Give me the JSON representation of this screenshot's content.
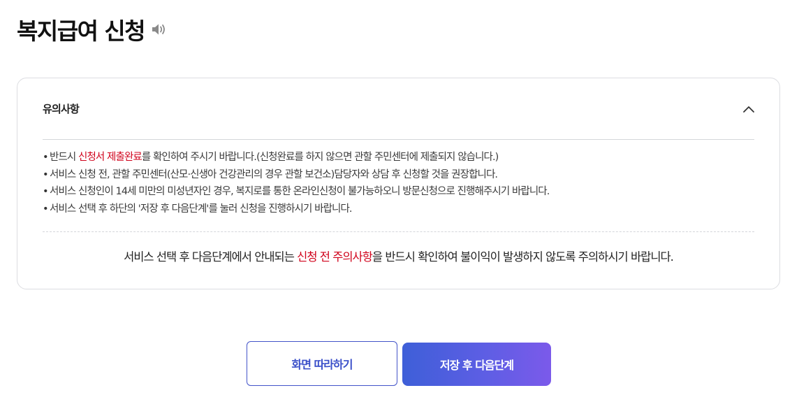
{
  "page": {
    "title": "복지급여 신청",
    "speaker_icon": "speaker-icon"
  },
  "notice": {
    "title": "유의사항",
    "toggle_icon": "chevron-up-icon",
    "items": [
      {
        "bullet": "•",
        "before": "반드시 ",
        "highlight": "신청서 제출완료",
        "after": "를 확인하여 주시기 바랍니다.(신청완료를 하지 않으면 관할 주민센터에 제출되지 않습니다.)"
      },
      {
        "bullet": "•",
        "text": "서비스 신청 전, 관할 주민센터(산모·신생아 건강관리의 경우 관할 보건소)담당자와 상담 후 신청할 것을 권장합니다."
      },
      {
        "bullet": "•",
        "text": "서비스 신청인이 14세 미만의 미성년자인 경우, 복지로를 통한 온라인신청이 불가능하오니 방문신청으로 진행해주시기 바랍니다."
      },
      {
        "bullet": "•",
        "text": "서비스 선택 후 하단의 '저장 후 다음단계'를 눌러 신청을 진행하시기 바랍니다."
      }
    ],
    "footer": {
      "before": "서비스 선택 후 다음단계에서 안내되는 ",
      "highlight": "신청 전 주의사항",
      "after": "을 반드시 확인하여 불이익이 발생하지 않도록 주의하시기 바랍니다."
    }
  },
  "buttons": {
    "follow_label": "화면 따라하기",
    "next_label": "저장 후 다음단계"
  },
  "colors": {
    "highlight": "#d0021b",
    "primary": "#4354c9",
    "gradient_start": "#3e5fd8",
    "gradient_end": "#7b5aea"
  }
}
